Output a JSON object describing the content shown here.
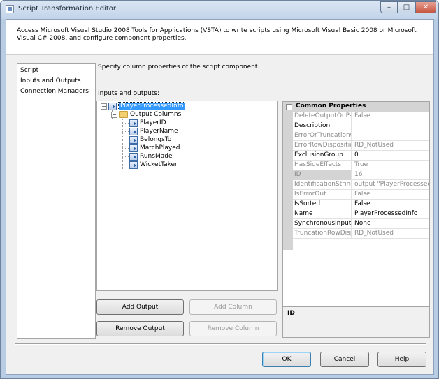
{
  "window": {
    "title": "Script Transformation Editor",
    "controls": {
      "minimize": "–",
      "maximize": "□",
      "close": "✕"
    }
  },
  "header": {
    "description": "Access Microsoft Visual Studio 2008 Tools for Applications (VSTA) to write scripts using Microsoft Visual Basic 2008 or Microsoft Visual C# 2008, and configure component properties."
  },
  "nav": {
    "items": [
      "Script",
      "Inputs and Outputs",
      "Connection Managers"
    ]
  },
  "main": {
    "instruction": "Specify column properties of the script component.",
    "io_label": "Inputs and outputs:"
  },
  "tree": {
    "root": "PlayerProcessedInfo",
    "folder": "Output Columns",
    "columns": [
      "PlayerID",
      "PlayerName",
      "BelongsTo",
      "MatchPlayed",
      "RunsMade",
      "WicketTaken"
    ]
  },
  "properties": {
    "header": "Common Properties",
    "rows": [
      {
        "name": "DeleteOutputOnPatl",
        "value": "False",
        "dim": true
      },
      {
        "name": "Description",
        "value": "",
        "dim": false
      },
      {
        "name": "ErrorOrTruncationO",
        "value": "",
        "dim": true
      },
      {
        "name": "ErrorRowDisposition",
        "value": "RD_NotUsed",
        "dim": true
      },
      {
        "name": "ExclusionGroup",
        "value": "0",
        "dim": false
      },
      {
        "name": "HasSideEffects",
        "value": "True",
        "dim": true
      },
      {
        "name": "ID",
        "value": "16",
        "dim": true
      },
      {
        "name": "IdentificationString",
        "value": "output \"PlayerProcessedInf",
        "dim": true
      },
      {
        "name": "IsErrorOut",
        "value": "False",
        "dim": true
      },
      {
        "name": "IsSorted",
        "value": "False",
        "dim": false
      },
      {
        "name": "Name",
        "value": "PlayerProcessedInfo",
        "dim": false
      },
      {
        "name": "SynchronousInputID",
        "value": "None",
        "dim": false
      },
      {
        "name": "TruncationRowDispo",
        "value": "RD_NotUsed",
        "dim": true
      }
    ],
    "description_title": "ID"
  },
  "buttons": {
    "add_output": "Add Output",
    "add_column": "Add Column",
    "remove_output": "Remove Output",
    "remove_column": "Remove Column",
    "ok": "OK",
    "cancel": "Cancel",
    "help": "Help"
  }
}
